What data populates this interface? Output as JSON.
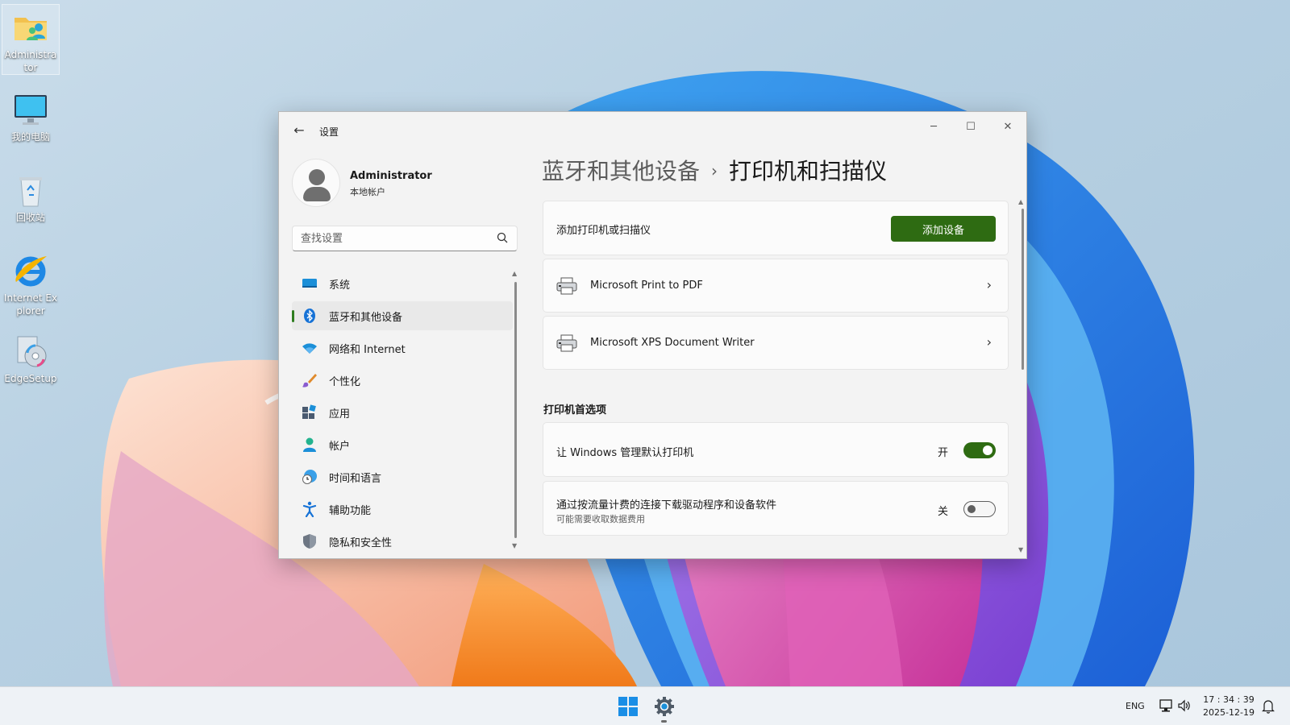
{
  "desktop": {
    "icons": [
      {
        "label": "Administrator",
        "icon": "user-folder-icon"
      },
      {
        "label": "我的电脑",
        "icon": "computer-icon"
      },
      {
        "label": "回收站",
        "icon": "recycle-bin-icon"
      },
      {
        "label": "Internet Explorer",
        "icon": "internet-explorer-icon"
      },
      {
        "label": "EdgeSetup",
        "icon": "installer-icon"
      }
    ]
  },
  "window": {
    "title": "设置",
    "back_icon": "back-arrow-icon",
    "controls": {
      "minimize": "minimize-icon",
      "maximize": "maximize-icon",
      "close": "close-icon"
    }
  },
  "profile": {
    "name": "Administrator",
    "account_type": "本地帐户"
  },
  "search": {
    "placeholder": "查找设置",
    "value": ""
  },
  "nav": {
    "items": [
      {
        "label": "系统",
        "icon": "system-icon"
      },
      {
        "label": "蓝牙和其他设备",
        "icon": "bluetooth-icon",
        "active": true
      },
      {
        "label": "网络和 Internet",
        "icon": "wifi-icon"
      },
      {
        "label": "个性化",
        "icon": "brush-icon"
      },
      {
        "label": "应用",
        "icon": "apps-icon"
      },
      {
        "label": "帐户",
        "icon": "account-icon"
      },
      {
        "label": "时间和语言",
        "icon": "clock-globe-icon"
      },
      {
        "label": "辅助功能",
        "icon": "accessibility-icon"
      },
      {
        "label": "隐私和安全性",
        "icon": "shield-icon"
      }
    ]
  },
  "breadcrumb": {
    "parent": "蓝牙和其他设备",
    "separator": "›",
    "current": "打印机和扫描仪"
  },
  "add_printer": {
    "label": "添加打印机或扫描仪",
    "button": "添加设备"
  },
  "printers": [
    {
      "name": "Microsoft Print to PDF"
    },
    {
      "name": "Microsoft XPS Document Writer"
    }
  ],
  "preferences": {
    "heading": "打印机首选项",
    "items": [
      {
        "label": "让 Windows 管理默认打印机",
        "state_label": "开",
        "on": true
      },
      {
        "label": "通过按流量计费的连接下载驱动程序和设备软件",
        "sublabel": "可能需要收取数据费用",
        "state_label": "关",
        "on": false
      }
    ]
  },
  "taskbar": {
    "language": "ENG",
    "time": "17 : 34 : 39",
    "date": "2025-12-19"
  },
  "colors": {
    "accent": "#2e6b12",
    "window_bg": "#f3f3f3",
    "card_bg": "#fbfbfb"
  }
}
